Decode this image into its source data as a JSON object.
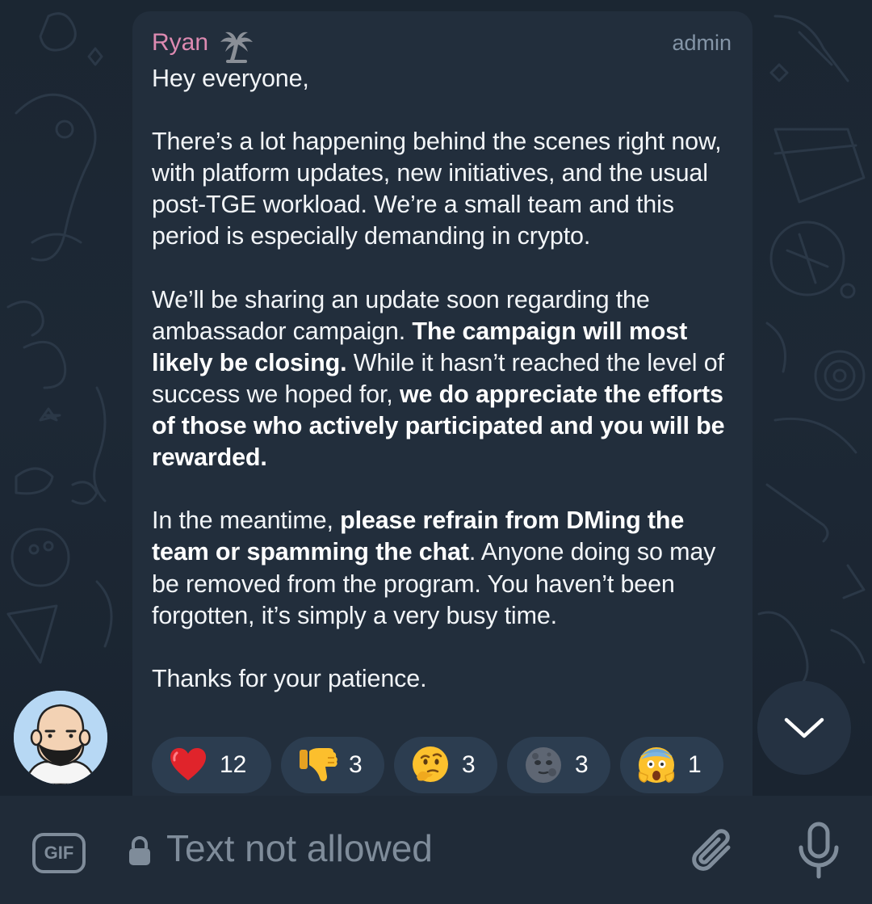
{
  "message": {
    "sender": "Ryan",
    "sender_emoji": "palm-tree-icon",
    "role": "admin",
    "greeting": "Hey everyone,",
    "p1": "There’s a lot happening behind the scenes right now, with platform updates, new initiatives, and the usual post-TGE workload. We’re a small team and this period is especially demanding in crypto.",
    "p2_a": "We’ll be sharing an update soon regarding the ambassador campaign. ",
    "p2_b": "The campaign will most likely be closing.",
    "p2_c": " While it hasn’t reached the level of success we hoped for, ",
    "p2_d": "we do appreciate the efforts of those who actively participated and you will be rewarded.",
    "p3_a": "In the meantime, ",
    "p3_b": "please refrain from DMing the team or spamming the chat",
    "p3_c": ". Anyone doing so may be removed from the program. You haven’t been forgotten, it’s simply a very busy time.",
    "p4": "Thanks for your patience."
  },
  "reactions": [
    {
      "emoji": "red-heart",
      "count": "12"
    },
    {
      "emoji": "thumbs-down",
      "count": "3"
    },
    {
      "emoji": "thinking-face",
      "count": "3"
    },
    {
      "emoji": "new-moon-face",
      "count": "3"
    },
    {
      "emoji": "screaming-face",
      "count": "1"
    }
  ],
  "composer": {
    "gif_label": "GIF",
    "placeholder": "Text not allowed"
  },
  "colors": {
    "sender": "#dd8ab1",
    "bubble": "#222e3c",
    "reaction_pill": "#2c3d50",
    "muted": "#7f8c9a"
  }
}
